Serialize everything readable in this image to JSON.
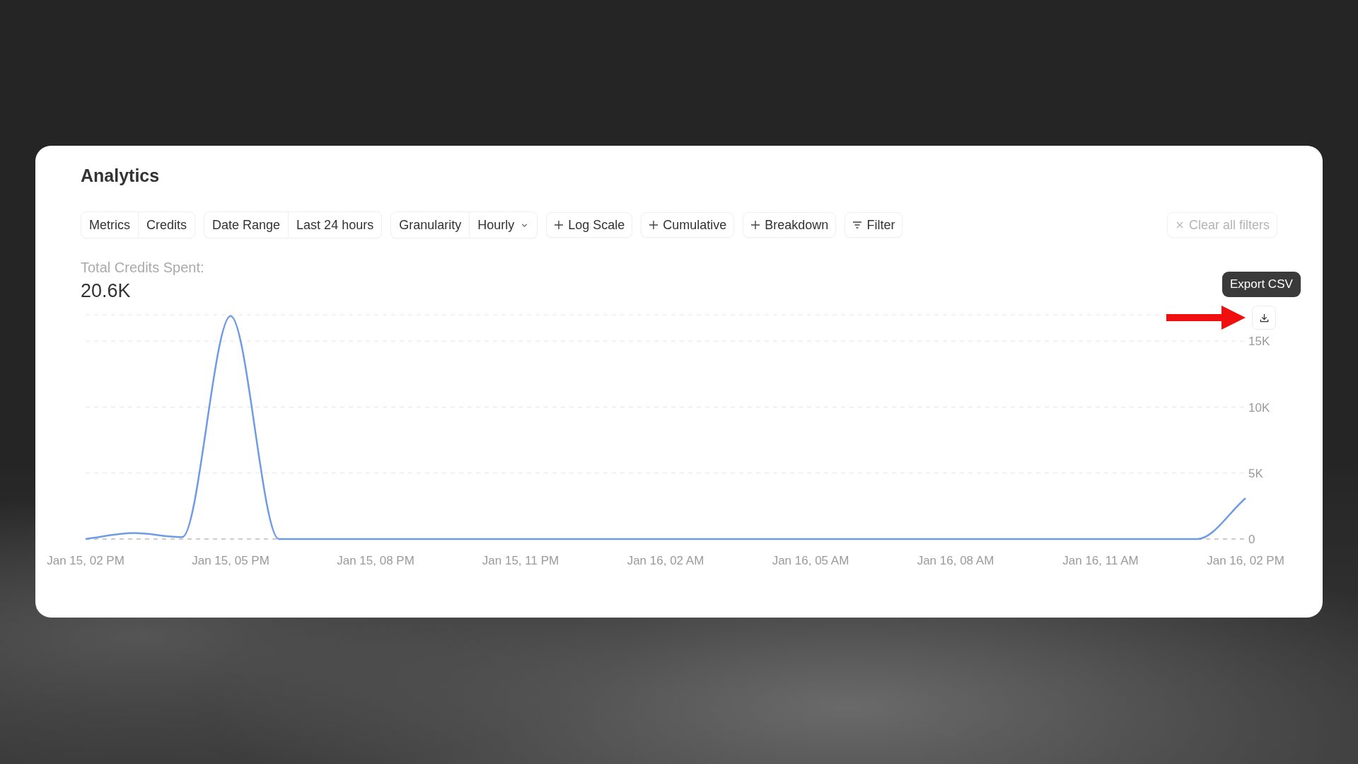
{
  "title": "Analytics",
  "toolbar": {
    "groups": [
      {
        "kind": "pair",
        "label": "Metrics",
        "value": "Credits"
      },
      {
        "kind": "pair",
        "label": "Date Range",
        "value": "Last 24 hours"
      },
      {
        "kind": "select",
        "label": "Granularity",
        "value": "Hourly"
      },
      {
        "kind": "add",
        "label": "Log Scale"
      },
      {
        "kind": "add",
        "label": "Cumulative"
      },
      {
        "kind": "add",
        "label": "Breakdown"
      },
      {
        "kind": "filter",
        "label": "Filter"
      }
    ],
    "clear_button": {
      "label": "Clear all filters",
      "disabled": true
    }
  },
  "summary": {
    "label": "Total Credits Spent:",
    "value": "20.6K"
  },
  "export": {
    "tooltip": "Export CSV"
  },
  "chart_data": {
    "type": "line",
    "categories": [
      "Jan 15, 02 PM",
      null,
      null,
      "Jan 15, 05 PM",
      null,
      null,
      "Jan 15, 08 PM",
      null,
      null,
      "Jan 15, 11 PM",
      null,
      null,
      "Jan 16, 02 AM",
      null,
      null,
      "Jan 16, 05 AM",
      null,
      null,
      "Jan 16, 08 AM",
      null,
      null,
      "Jan 16, 11 AM",
      null,
      null,
      "Jan 16, 02 PM"
    ],
    "series": [
      {
        "color": "#6f9be6",
        "values": [
          0,
          450,
          150,
          16900,
          0,
          0,
          0,
          0,
          0,
          0,
          0,
          0,
          0,
          0,
          0,
          0,
          0,
          0,
          0,
          0,
          0,
          0,
          0,
          0,
          3100
        ]
      }
    ],
    "ylim": [
      0,
      17000
    ],
    "grid": true,
    "yticks": [
      {
        "value": 0,
        "label": "0"
      },
      {
        "value": 5000,
        "label": "5K"
      },
      {
        "value": 10000,
        "label": "10K"
      },
      {
        "value": 15000,
        "label": "15K"
      }
    ]
  }
}
